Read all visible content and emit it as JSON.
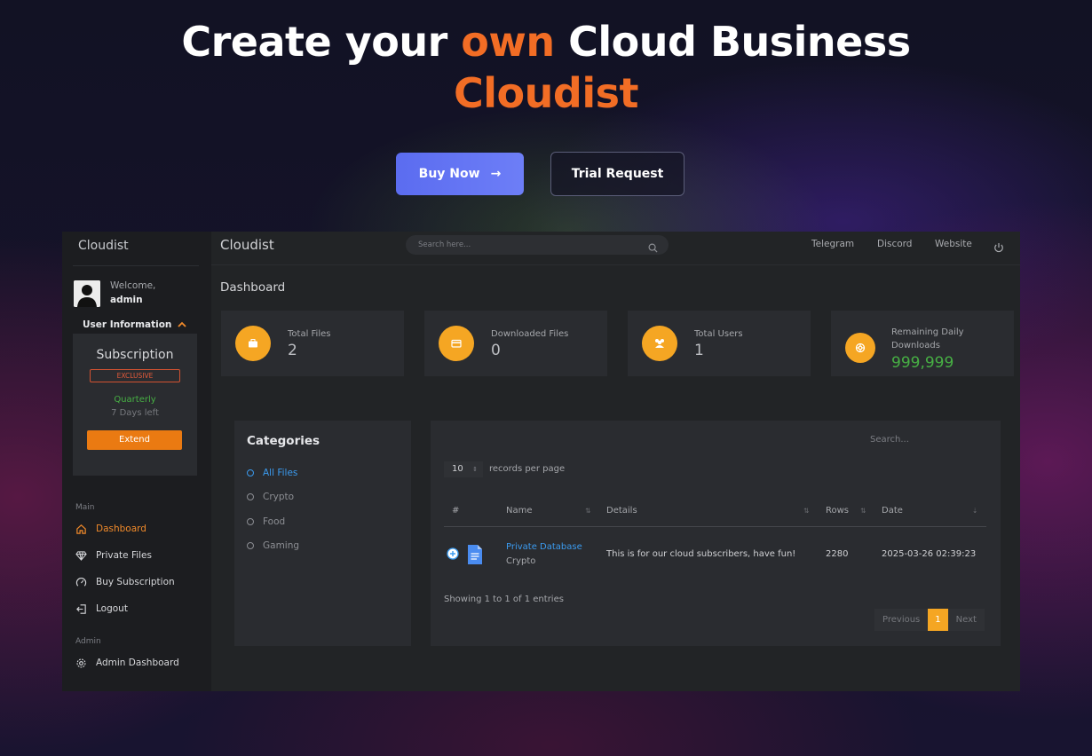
{
  "hero": {
    "title_part1": "Create your ",
    "title_accent": "own",
    "title_part2": " Cloud Business",
    "brand": "Cloudist",
    "buy_label": "Buy Now",
    "buy_arrow": "→",
    "trial_label": "Trial Request",
    "accent_color": "#f26d25"
  },
  "app": {
    "sidebar": {
      "brand": "Cloudist",
      "welcome": "Welcome,",
      "username": "admin",
      "user_info_label": "User Information",
      "subscription": {
        "title": "Subscription",
        "badge": "EXCLUSIVE",
        "plan": "Quarterly",
        "days_left": "7 Days left",
        "extend_label": "Extend"
      },
      "main_section": "Main",
      "main_items": [
        {
          "label": "Dashboard",
          "icon": "home-icon",
          "active": true
        },
        {
          "label": "Private Files",
          "icon": "diamond-icon"
        },
        {
          "label": "Buy Subscription",
          "icon": "gauge-icon"
        },
        {
          "label": "Logout",
          "icon": "logout-icon"
        }
      ],
      "admin_section": "Admin",
      "admin_items": [
        {
          "label": "Admin Dashboard",
          "icon": "gear-icon"
        }
      ]
    },
    "topbar": {
      "brand": "Cloudist",
      "search_placeholder": "Search here...",
      "links": [
        "Telegram",
        "Discord",
        "Website"
      ]
    },
    "page_title": "Dashboard",
    "stats": [
      {
        "label": "Total Files",
        "value": "2",
        "icon": "briefcase-icon"
      },
      {
        "label": "Downloaded Files",
        "value": "0",
        "icon": "card-icon"
      },
      {
        "label": "Total Users",
        "value": "1",
        "icon": "users-icon"
      },
      {
        "label_line1": "Remaining Daily",
        "label_line2": "Downloads",
        "value": "999,999",
        "icon": "lifebuoy-icon",
        "value_color": "#47b044"
      }
    ],
    "categories": {
      "title": "Categories",
      "items": [
        "All Files",
        "Crypto",
        "Food",
        "Gaming"
      ],
      "active": "All Files"
    },
    "table": {
      "search_placeholder": "Search...",
      "page_size": "10",
      "records_per_page": "records per page",
      "columns": [
        "#",
        "Name",
        "Details",
        "Rows",
        "Date"
      ],
      "rows": [
        {
          "name": "Private Database",
          "category": "Crypto",
          "details": "This is for our cloud subscribers, have fun!",
          "rows": "2280",
          "date": "2025-03-26 02:39:23"
        }
      ],
      "showing": "Showing 1 to 1 of 1 entries",
      "pager": {
        "previous": "Previous",
        "current": "1",
        "next": "Next"
      }
    }
  }
}
